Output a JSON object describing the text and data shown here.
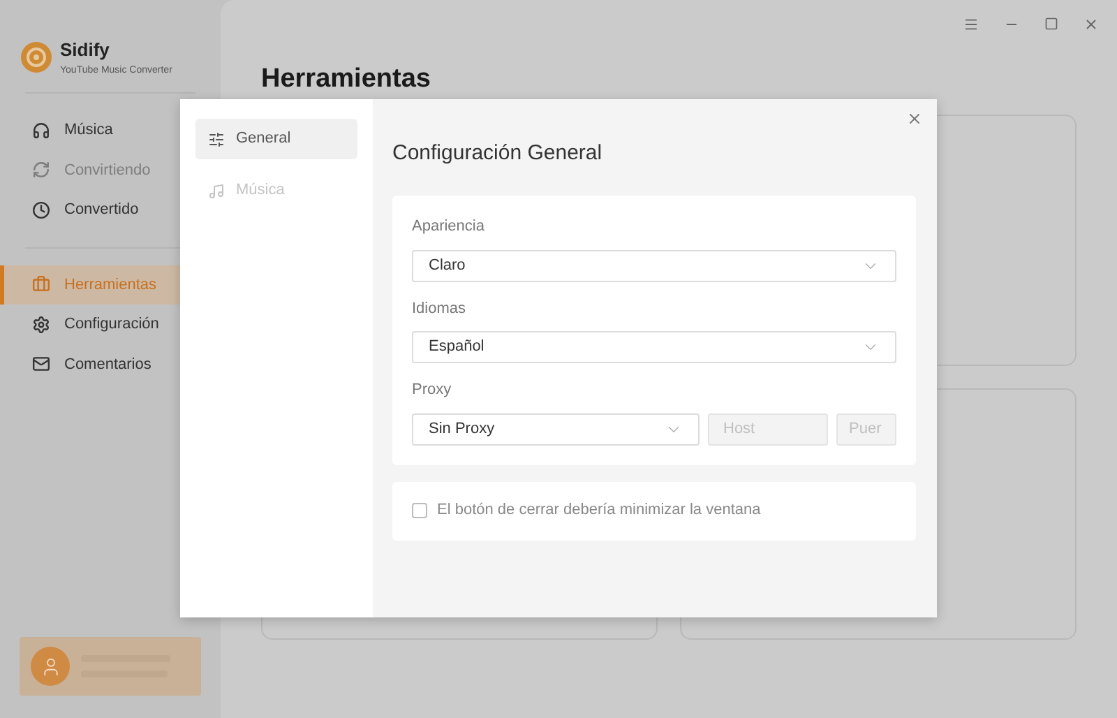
{
  "app": {
    "name": "Sidify",
    "subtitle": "YouTube Music Converter"
  },
  "sidebar": {
    "items": [
      {
        "label": "Música",
        "selected": false,
        "disabled": false
      },
      {
        "label": "Convirtiendo",
        "selected": false,
        "disabled": true
      },
      {
        "label": "Convertido",
        "selected": false,
        "disabled": false
      },
      {
        "label": "Herramientas",
        "selected": true,
        "disabled": false
      },
      {
        "label": "Configuración",
        "selected": false,
        "disabled": false
      },
      {
        "label": "Comentarios",
        "selected": false,
        "disabled": false
      }
    ]
  },
  "page": {
    "title": "Herramientas"
  },
  "dialog": {
    "nav": [
      {
        "label": "General",
        "selected": true,
        "disabled": false
      },
      {
        "label": "Música",
        "selected": false,
        "disabled": true
      }
    ],
    "title": "Configuración General",
    "fields": [
      {
        "label": "Apariencia",
        "value": "Claro"
      },
      {
        "label": "Idiomas",
        "value": "Español"
      }
    ],
    "proxy": {
      "label": "Proxy",
      "value": "Sin Proxy",
      "host": {
        "placeholder": "Host",
        "disabled": true
      },
      "port": {
        "placeholder": "Puer",
        "disabled": true
      }
    },
    "option": {
      "label": "El botón de cerrar debería minimizar la ventana",
      "checked": false
    }
  }
}
